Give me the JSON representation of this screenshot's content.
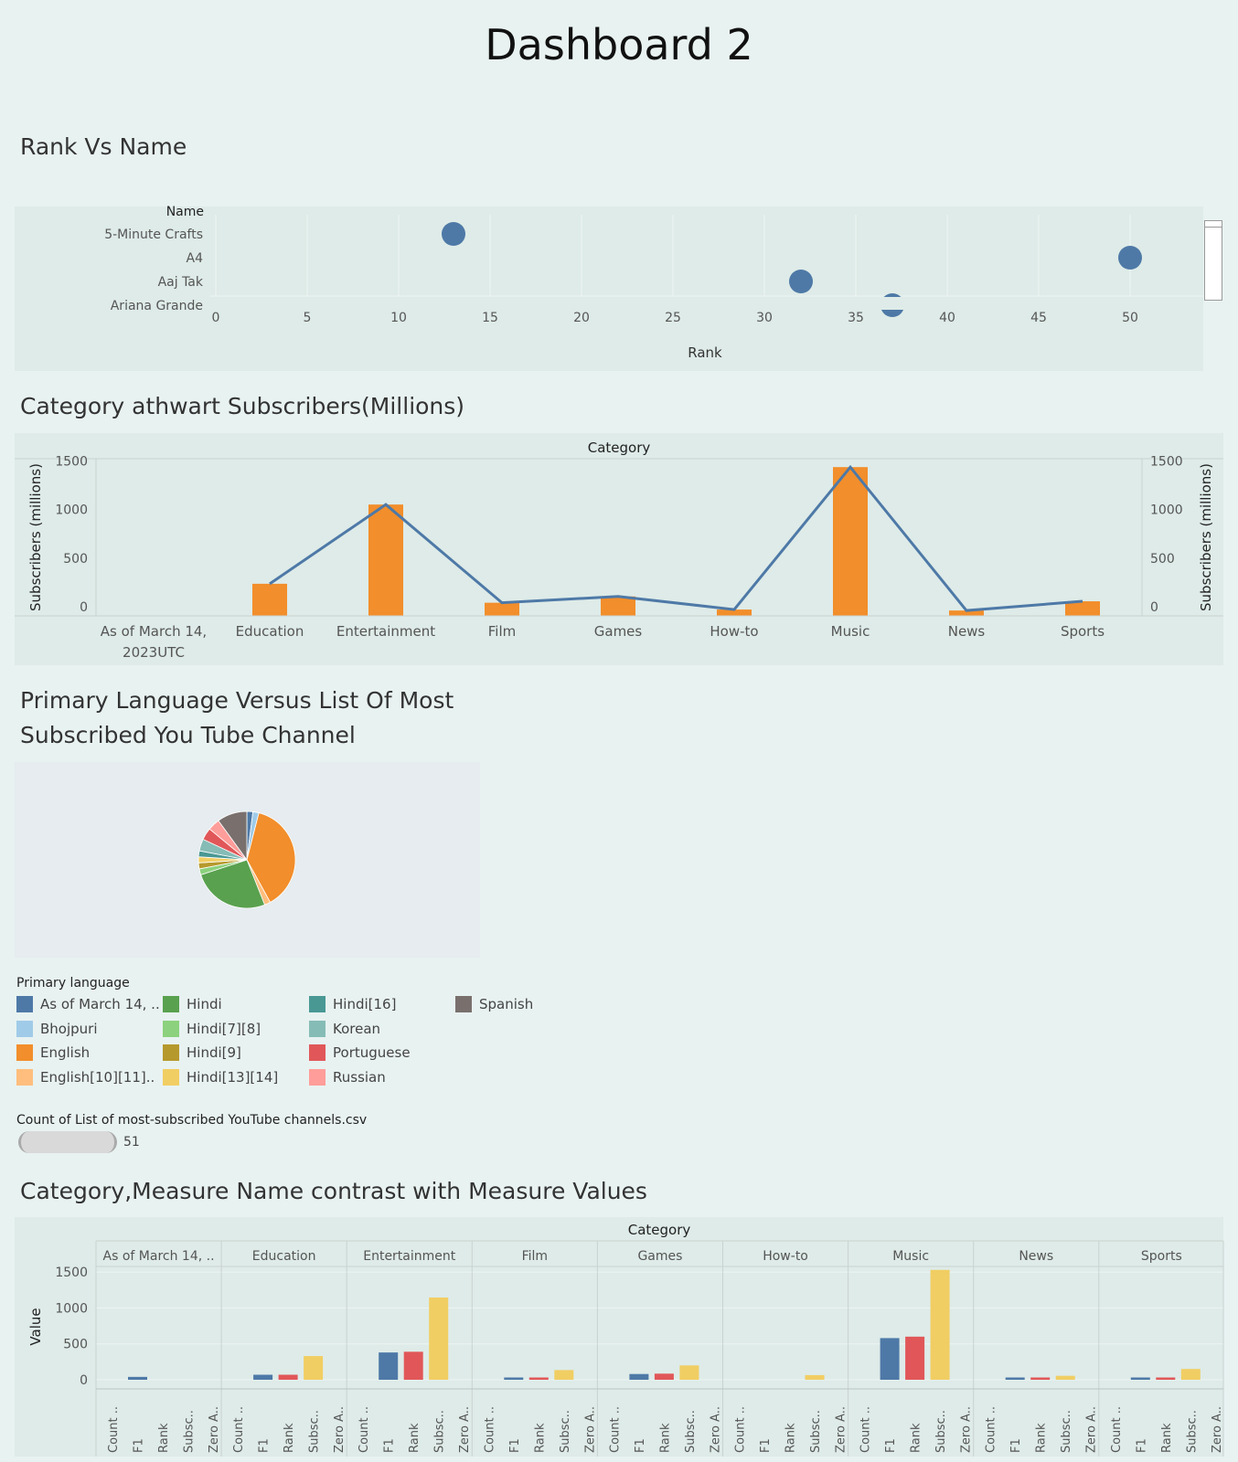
{
  "page_title": "Dashboard 2",
  "sections": {
    "rank_vs_name": "Rank Vs Name",
    "category_subscribers": "Category  athwart Subscribers(Millions)",
    "primary_language_line1": "Primary Language Versus List Of Most",
    "primary_language_line2": "Subscribed You Tube Channel",
    "category_measure": "Category,Measure Name contrast with Measure Values"
  },
  "chart_data": [
    {
      "type": "scatter",
      "title": "Rank Vs Name",
      "xlabel": "Rank",
      "ylabel": "Name",
      "xlim": [
        0,
        54
      ],
      "x_ticks": [
        0,
        5,
        10,
        15,
        20,
        25,
        30,
        35,
        40,
        45,
        50
      ],
      "categories": [
        "5-Minute Crafts",
        "A4",
        "Aaj Tak",
        "Ariana Grande"
      ],
      "category_labels": [
        "5-Minute Crafts",
        "A4",
        "Aaj Tak",
        "Ariana Grande"
      ],
      "points": [
        {
          "name": "5-Minute Crafts",
          "rank": 13
        },
        {
          "name": "A4",
          "rank": 50
        },
        {
          "name": "Aaj Tak",
          "rank": 32
        },
        {
          "name": "Ariana Grande",
          "rank": 37
        }
      ],
      "color": "#4e79a7",
      "grid": true
    },
    {
      "type": "bar",
      "title": "Category  athwart Subscribers(Millions)",
      "header": "Category",
      "ylabel": "Subscribers (millions)",
      "ylabel_right": "Subscribers (millions)",
      "ylim": [
        0,
        1580
      ],
      "y_ticks": [
        0,
        500,
        1000,
        1500
      ],
      "categories": [
        "As of March 14, 2023UTC",
        "Education",
        "Entertainment",
        "Film",
        "Games",
        "How-to",
        "Music",
        "News",
        "Sports"
      ],
      "category_lines": [
        [
          "As of March 14,",
          "2023UTC"
        ],
        [
          "Education"
        ],
        [
          "Entertainment"
        ],
        [
          "Film"
        ],
        [
          "Games"
        ],
        [
          "How-to"
        ],
        [
          "Music"
        ],
        [
          "News"
        ],
        [
          "Sports"
        ]
      ],
      "series": [
        {
          "type": "bar",
          "values": [
            0,
            330,
            1145,
            135,
            200,
            65,
            1530,
            55,
            150
          ],
          "color": "#f28e2b"
        },
        {
          "type": "line",
          "values": [
            null,
            330,
            1145,
            135,
            200,
            65,
            1530,
            55,
            150
          ],
          "color": "#4e79a7"
        }
      ],
      "grid": false
    },
    {
      "type": "pie",
      "title": "Primary Language Versus List Of Most Subscribed You Tube Channel",
      "legend_title": "Primary language",
      "legend_placement": "bottom",
      "slices": [
        {
          "label": "As of March 14, ..",
          "value": 1,
          "color": "#4e79a7"
        },
        {
          "label": "Bhojpuri",
          "value": 1,
          "color": "#a0cbe8"
        },
        {
          "label": "English",
          "value": 19,
          "color": "#f28e2b"
        },
        {
          "label": "English[10][11]..",
          "value": 1,
          "color": "#ffbe7d"
        },
        {
          "label": "Hindi",
          "value": 13,
          "color": "#59a14f"
        },
        {
          "label": "Hindi[7][8]",
          "value": 1,
          "color": "#8cd17d"
        },
        {
          "label": "Hindi[9]",
          "value": 1,
          "color": "#b6992d"
        },
        {
          "label": "Hindi[13][14]",
          "value": 1,
          "color": "#f1ce63"
        },
        {
          "label": "Hindi[16]",
          "value": 1,
          "color": "#499894"
        },
        {
          "label": "Korean",
          "value": 2,
          "color": "#86bcb6"
        },
        {
          "label": "Portuguese",
          "value": 2,
          "color": "#e15759"
        },
        {
          "label": "Russian",
          "value": 2,
          "color": "#ff9d9a"
        },
        {
          "label": "Spanish",
          "value": 5,
          "color": "#79706e"
        }
      ],
      "count_title": "Count of List of most-subscribed YouTube channels.csv",
      "count_value": "51"
    },
    {
      "type": "bar",
      "title": "Category,Measure Name contrast with Measure Values",
      "header": "Category",
      "ylabel": "Value",
      "ylim": [
        -150,
        1600
      ],
      "y_ticks": [
        0,
        500,
        1000,
        1500
      ],
      "panels": [
        "As of March 14, ..",
        "Education",
        "Entertainment",
        "Film",
        "Games",
        "How-to",
        "Music",
        "News",
        "Sports"
      ],
      "measures": [
        "Count ..",
        "F1",
        "Rank",
        "Subsc..",
        "Zero A.."
      ],
      "measure_colors": [
        "#4e79a7",
        "#4e79a7",
        "#e15759",
        "#f1ce63",
        "#f1ce63"
      ],
      "series": [
        {
          "name": "Count ..",
          "values": [
            0,
            0,
            0,
            0,
            0,
            0,
            0,
            0,
            0
          ]
        },
        {
          "name": "F1",
          "values": [
            40,
            70,
            380,
            25,
            80,
            0,
            580,
            20,
            20
          ]
        },
        {
          "name": "Rank",
          "values": [
            0,
            70,
            390,
            20,
            85,
            0,
            600,
            20,
            20
          ]
        },
        {
          "name": "Subsc..",
          "values": [
            0,
            330,
            1145,
            135,
            200,
            65,
            1530,
            55,
            150
          ]
        },
        {
          "name": "Zero A..",
          "values": [
            0,
            0,
            0,
            0,
            0,
            0,
            0,
            0,
            0
          ]
        }
      ]
    }
  ]
}
